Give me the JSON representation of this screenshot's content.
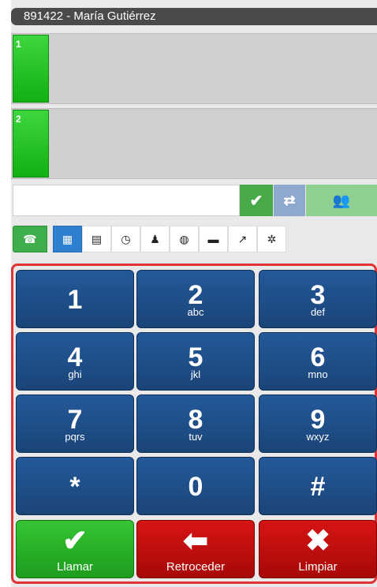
{
  "header": {
    "title": "891422 - María Gutiérrez"
  },
  "lines": [
    {
      "number": "1"
    },
    {
      "number": "2"
    }
  ],
  "dial": {
    "value": "",
    "check_icon": "check-icon",
    "transfer_icon": "transfer-icon",
    "conference_icon": "group-icon"
  },
  "toolbar": {
    "icons": [
      "phone-icon",
      "keypad-icon",
      "list-icon",
      "clock-icon",
      "user-icon",
      "globe-icon",
      "chat-icon",
      "share-icon",
      "gear-icon"
    ]
  },
  "keypad": {
    "keys": [
      {
        "digit": "1",
        "letters": ""
      },
      {
        "digit": "2",
        "letters": "abc"
      },
      {
        "digit": "3",
        "letters": "def"
      },
      {
        "digit": "4",
        "letters": "ghi"
      },
      {
        "digit": "5",
        "letters": "jkl"
      },
      {
        "digit": "6",
        "letters": "mno"
      },
      {
        "digit": "7",
        "letters": "pqrs"
      },
      {
        "digit": "8",
        "letters": "tuv"
      },
      {
        "digit": "9",
        "letters": "wxyz"
      },
      {
        "digit": "*",
        "letters": ""
      },
      {
        "digit": "0",
        "letters": ""
      },
      {
        "digit": "#",
        "letters": ""
      }
    ],
    "actions": {
      "call": "Llamar",
      "back": "Retroceder",
      "clear": "Limpiar"
    }
  },
  "colors": {
    "call": "#1d9d1d",
    "back": "#b00a0a",
    "keys": "#1a4a84",
    "frame": "#e03434"
  }
}
